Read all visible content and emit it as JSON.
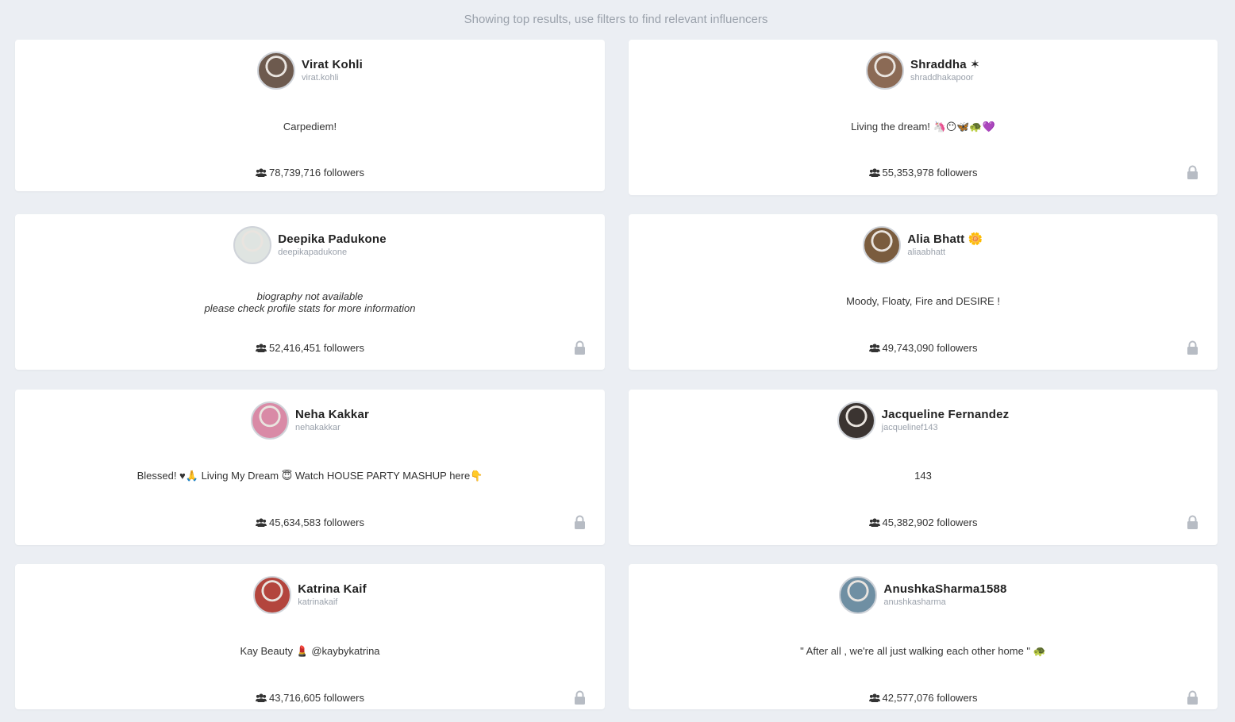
{
  "notice": "Showing top results, use filters to find relevant influencers",
  "followers_suffix": "followers",
  "colors": {
    "background": "#ebeef3",
    "card": "#ffffff",
    "muted": "#9aa1ab",
    "lock": "#b7bcc4"
  },
  "influencers": [
    {
      "name": "Virat Kohli",
      "handle": "virat.kohli",
      "bio": "Carpediem!",
      "bio_available": true,
      "followers": "78,739,716",
      "locked": false,
      "avatar_color": "#6d5a4e"
    },
    {
      "name": "Shraddha ✶",
      "handle": "shraddhakapoor",
      "bio": "Living the dream! 🦄😶🦋🐢💜",
      "bio_available": true,
      "followers": "55,353,978",
      "locked": true,
      "avatar_color": "#8b6a55"
    },
    {
      "name": "Deepika Padukone",
      "handle": "deepikapadukone",
      "bio_na_line1": "biography not available",
      "bio_na_line2": "please check profile stats for more information",
      "bio_available": false,
      "followers": "52,416,451",
      "locked": true,
      "avatar_color": "#dfe4e1"
    },
    {
      "name": "Alia Bhatt 🌼",
      "handle": "aliaabhatt",
      "bio": "Moody, Floaty, Fire and DESIRE !",
      "bio_available": true,
      "followers": "49,743,090",
      "locked": true,
      "avatar_color": "#7a5c3e"
    },
    {
      "name": "Neha Kakkar",
      "handle": "nehakakkar",
      "bio": "Blessed! ♥🙏 Living My Dream 😇 Watch HOUSE PARTY MASHUP here👇",
      "bio_available": true,
      "followers": "45,634,583",
      "locked": true,
      "avatar_color": "#d98aa6"
    },
    {
      "name": "Jacqueline Fernandez",
      "handle": "jacquelinef143",
      "bio": "143",
      "bio_available": true,
      "followers": "45,382,902",
      "locked": true,
      "avatar_color": "#3b3431"
    },
    {
      "name": "Katrina Kaif",
      "handle": "katrinakaif",
      "bio": "Kay Beauty 💄 @kaybykatrina",
      "bio_available": true,
      "followers": "43,716,605",
      "locked": true,
      "avatar_color": "#b3453d"
    },
    {
      "name": "AnushkaSharma1588",
      "handle": "anushkasharma",
      "bio": "\" After all , we're all just walking each other home \" 🐢",
      "bio_available": true,
      "followers": "42,577,076",
      "locked": true,
      "avatar_color": "#6f8fa3"
    }
  ]
}
